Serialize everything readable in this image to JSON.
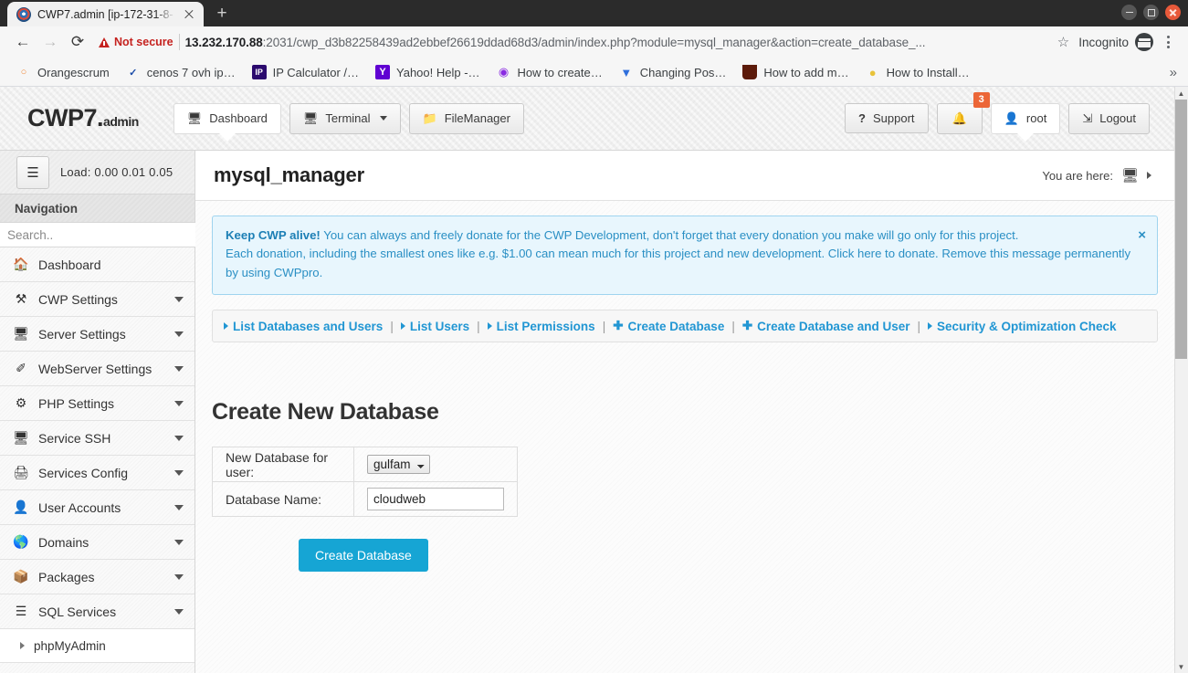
{
  "browser": {
    "tab": {
      "title": "CWP7.admin [ip-172-31-8-",
      "favicon": "cwp-icon"
    },
    "new_tab_label": "+",
    "window_controls": {
      "minimize": "minimize-icon",
      "maximize": "maximize-icon",
      "close": "close-icon"
    },
    "nav": {
      "back": "←",
      "forward": "→",
      "reload": "⟳"
    },
    "security_label": "Not secure",
    "url_host": "13.232.170.88",
    "url_rest": ":2031/cwp_d3b82258439ad2ebbef26619ddad68d3/admin/index.php?module=mysql_manager&action=create_database_...",
    "star_icon": "☆",
    "profile_label": "Incognito",
    "bookmarks": [
      {
        "label": "Orangescrum",
        "icon": "🍑",
        "color": "#f08a3c"
      },
      {
        "label": "cenos 7 ovh ip…",
        "icon": "V",
        "color": "#1a4ba8"
      },
      {
        "label": "IP Calculator /…",
        "icon": "IP",
        "color": "#2b0a6e"
      },
      {
        "label": "Yahoo! Help -…",
        "icon": "Y",
        "color": "#6001d2"
      },
      {
        "label": "How to create…",
        "icon": "◎",
        "color": "#8a2be2"
      },
      {
        "label": "Changing Pos…",
        "icon": "V",
        "color": "#2f6fdc"
      },
      {
        "label": "How to add m…",
        "icon": "U",
        "color": "#5c1a0a"
      },
      {
        "label": "How to Install…",
        "icon": "💡",
        "color": "#e8c33a"
      }
    ],
    "overflow_label": "»"
  },
  "header": {
    "logo_main": "CWP7",
    "logo_dot": ".",
    "logo_sub": "admin",
    "nav": [
      {
        "label": "Dashboard",
        "icon": "🖥",
        "active": true,
        "caret": false
      },
      {
        "label": "Terminal",
        "icon": "🖥",
        "active": false,
        "caret": true
      },
      {
        "label": "FileManager",
        "icon": "🗂",
        "active": false,
        "caret": false
      }
    ],
    "right": [
      {
        "label": "Support",
        "icon": "?"
      },
      {
        "label": "",
        "icon": "🔔",
        "badge": "3"
      },
      {
        "label": "root",
        "icon": "👤",
        "active": true
      },
      {
        "label": "Logout",
        "icon": "↪"
      }
    ]
  },
  "sidebar": {
    "load_icon": "database-icon",
    "load_text": "Load: 0.00  0.01  0.05",
    "nav_title": "Navigation",
    "search_placeholder": "Search..",
    "items": [
      {
        "label": "Dashboard",
        "icon": "🏠",
        "caret": false
      },
      {
        "label": "CWP Settings",
        "icon": "⚒",
        "caret": true
      },
      {
        "label": "Server Settings",
        "icon": "🖥",
        "caret": true
      },
      {
        "label": "WebServer Settings",
        "icon": "✒",
        "caret": true
      },
      {
        "label": "PHP Settings",
        "icon": "⚙",
        "caret": true
      },
      {
        "label": "Service SSH",
        "icon": "🖥",
        "caret": true
      },
      {
        "label": "Services Config",
        "icon": "🖨",
        "caret": true
      },
      {
        "label": "User Accounts",
        "icon": "👤",
        "caret": true
      },
      {
        "label": "Domains",
        "icon": "🌐",
        "caret": true
      },
      {
        "label": "Packages",
        "icon": "📦",
        "caret": true
      },
      {
        "label": "SQL Services",
        "icon": "⌸",
        "caret": true
      }
    ],
    "sub_items": [
      {
        "label": "phpMyAdmin"
      }
    ]
  },
  "main": {
    "page_title": "mysql_manager",
    "you_are_here_label": "You are here:",
    "you_are_here_icon": "🖥",
    "alert": {
      "strong": "Keep CWP alive!",
      "line1": " You can always and freely donate for the CWP Development, don't forget that every donation you make will go only for this project.",
      "line2": "Each donation, including the smallest ones like e.g. $1.00 can mean much for this project and new development. Click here to donate. Remove this message permanently by using CWPpro.",
      "close": "×"
    },
    "tabs": [
      {
        "label": "List Databases and Users",
        "marker": "tri"
      },
      {
        "label": "List Users",
        "marker": "tri"
      },
      {
        "label": "List Permissions",
        "marker": "tri"
      },
      {
        "label": "Create Database",
        "marker": "plus"
      },
      {
        "label": "Create Database and User",
        "marker": "plus"
      },
      {
        "label": "Security & Optimization Check",
        "marker": "tri"
      }
    ],
    "tab_separator": "|",
    "form": {
      "title": "Create New Database",
      "row1_label": "New Database for user:",
      "row1_value": "gulfam",
      "row2_label": "Database Name:",
      "row2_value": "cloudweb",
      "submit_label": "Create Database"
    }
  },
  "colors": {
    "accent": "#16a5d4",
    "link": "#2196d3",
    "alert_bg": "#e8f6fd",
    "alert_border": "#9fd4ef",
    "badge": "#ec6637",
    "not_secure": "#c5221f"
  }
}
